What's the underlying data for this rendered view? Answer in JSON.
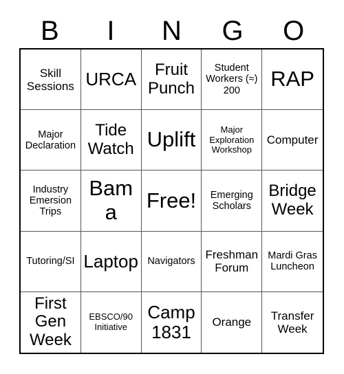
{
  "card": {
    "title": "BINGO Card",
    "header_letters": [
      "B",
      "I",
      "N",
      "G",
      "O"
    ],
    "grid_size": "5x5",
    "free_space_label": "Free!",
    "colors": {
      "background": "#ffffff",
      "text": "#000000",
      "outer_border": "#000000",
      "inner_border": "#555555"
    },
    "rows": [
      [
        {
          "text": "Skill Sessions",
          "size": "sm"
        },
        {
          "text": "URCA",
          "size": "lg"
        },
        {
          "text": "Fruit Punch",
          "size": "md"
        },
        {
          "text": "Student Workers (≈) 200",
          "size": "xs"
        },
        {
          "text": "RAP",
          "size": "xl"
        }
      ],
      [
        {
          "text": "Major Declaration",
          "size": "xs"
        },
        {
          "text": "Tide Watch",
          "size": "md"
        },
        {
          "text": "Uplift",
          "size": "xl"
        },
        {
          "text": "Major Exploration Workshop",
          "size": "xxs"
        },
        {
          "text": "Computer",
          "size": "sm"
        }
      ],
      [
        {
          "text": "Industry Emersion Trips",
          "size": "xs"
        },
        {
          "text": "Bama",
          "size": "xl"
        },
        {
          "text": "Free!",
          "size": "xl"
        },
        {
          "text": "Emerging Scholars",
          "size": "xs"
        },
        {
          "text": "Bridge Week",
          "size": "md"
        }
      ],
      [
        {
          "text": "Tutoring/SI",
          "size": "xs"
        },
        {
          "text": "Laptop",
          "size": "lg"
        },
        {
          "text": "Navigators",
          "size": "xs"
        },
        {
          "text": "Freshman Forum",
          "size": "sm"
        },
        {
          "text": "Mardi Gras Luncheon",
          "size": "xs"
        }
      ],
      [
        {
          "text": "First Gen Week",
          "size": "md"
        },
        {
          "text": "EBSCO/90 Initiative",
          "size": "xxs"
        },
        {
          "text": "Camp 1831",
          "size": "lg"
        },
        {
          "text": "Orange",
          "size": "sm"
        },
        {
          "text": "Transfer Week",
          "size": "sm"
        }
      ]
    ]
  }
}
